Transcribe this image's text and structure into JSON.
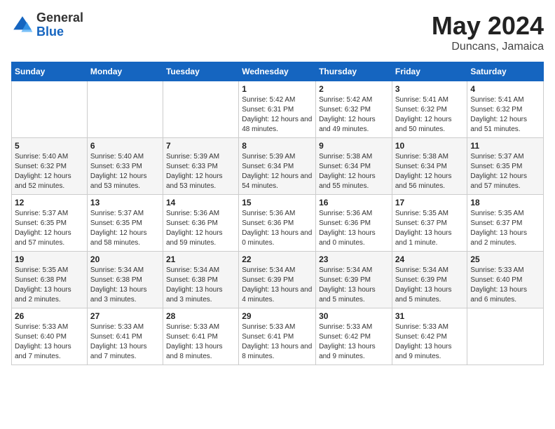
{
  "logo": {
    "general": "General",
    "blue": "Blue"
  },
  "title": "May 2024",
  "subtitle": "Duncans, Jamaica",
  "days_of_week": [
    "Sunday",
    "Monday",
    "Tuesday",
    "Wednesday",
    "Thursday",
    "Friday",
    "Saturday"
  ],
  "weeks": [
    [
      {
        "day": "",
        "sunrise": "",
        "sunset": "",
        "daylight": ""
      },
      {
        "day": "",
        "sunrise": "",
        "sunset": "",
        "daylight": ""
      },
      {
        "day": "",
        "sunrise": "",
        "sunset": "",
        "daylight": ""
      },
      {
        "day": "1",
        "sunrise": "Sunrise: 5:42 AM",
        "sunset": "Sunset: 6:31 PM",
        "daylight": "Daylight: 12 hours and 48 minutes."
      },
      {
        "day": "2",
        "sunrise": "Sunrise: 5:42 AM",
        "sunset": "Sunset: 6:32 PM",
        "daylight": "Daylight: 12 hours and 49 minutes."
      },
      {
        "day": "3",
        "sunrise": "Sunrise: 5:41 AM",
        "sunset": "Sunset: 6:32 PM",
        "daylight": "Daylight: 12 hours and 50 minutes."
      },
      {
        "day": "4",
        "sunrise": "Sunrise: 5:41 AM",
        "sunset": "Sunset: 6:32 PM",
        "daylight": "Daylight: 12 hours and 51 minutes."
      }
    ],
    [
      {
        "day": "5",
        "sunrise": "Sunrise: 5:40 AM",
        "sunset": "Sunset: 6:32 PM",
        "daylight": "Daylight: 12 hours and 52 minutes."
      },
      {
        "day": "6",
        "sunrise": "Sunrise: 5:40 AM",
        "sunset": "Sunset: 6:33 PM",
        "daylight": "Daylight: 12 hours and 53 minutes."
      },
      {
        "day": "7",
        "sunrise": "Sunrise: 5:39 AM",
        "sunset": "Sunset: 6:33 PM",
        "daylight": "Daylight: 12 hours and 53 minutes."
      },
      {
        "day": "8",
        "sunrise": "Sunrise: 5:39 AM",
        "sunset": "Sunset: 6:34 PM",
        "daylight": "Daylight: 12 hours and 54 minutes."
      },
      {
        "day": "9",
        "sunrise": "Sunrise: 5:38 AM",
        "sunset": "Sunset: 6:34 PM",
        "daylight": "Daylight: 12 hours and 55 minutes."
      },
      {
        "day": "10",
        "sunrise": "Sunrise: 5:38 AM",
        "sunset": "Sunset: 6:34 PM",
        "daylight": "Daylight: 12 hours and 56 minutes."
      },
      {
        "day": "11",
        "sunrise": "Sunrise: 5:37 AM",
        "sunset": "Sunset: 6:35 PM",
        "daylight": "Daylight: 12 hours and 57 minutes."
      }
    ],
    [
      {
        "day": "12",
        "sunrise": "Sunrise: 5:37 AM",
        "sunset": "Sunset: 6:35 PM",
        "daylight": "Daylight: 12 hours and 57 minutes."
      },
      {
        "day": "13",
        "sunrise": "Sunrise: 5:37 AM",
        "sunset": "Sunset: 6:35 PM",
        "daylight": "Daylight: 12 hours and 58 minutes."
      },
      {
        "day": "14",
        "sunrise": "Sunrise: 5:36 AM",
        "sunset": "Sunset: 6:36 PM",
        "daylight": "Daylight: 12 hours and 59 minutes."
      },
      {
        "day": "15",
        "sunrise": "Sunrise: 5:36 AM",
        "sunset": "Sunset: 6:36 PM",
        "daylight": "Daylight: 13 hours and 0 minutes."
      },
      {
        "day": "16",
        "sunrise": "Sunrise: 5:36 AM",
        "sunset": "Sunset: 6:36 PM",
        "daylight": "Daylight: 13 hours and 0 minutes."
      },
      {
        "day": "17",
        "sunrise": "Sunrise: 5:35 AM",
        "sunset": "Sunset: 6:37 PM",
        "daylight": "Daylight: 13 hours and 1 minute."
      },
      {
        "day": "18",
        "sunrise": "Sunrise: 5:35 AM",
        "sunset": "Sunset: 6:37 PM",
        "daylight": "Daylight: 13 hours and 2 minutes."
      }
    ],
    [
      {
        "day": "19",
        "sunrise": "Sunrise: 5:35 AM",
        "sunset": "Sunset: 6:38 PM",
        "daylight": "Daylight: 13 hours and 2 minutes."
      },
      {
        "day": "20",
        "sunrise": "Sunrise: 5:34 AM",
        "sunset": "Sunset: 6:38 PM",
        "daylight": "Daylight: 13 hours and 3 minutes."
      },
      {
        "day": "21",
        "sunrise": "Sunrise: 5:34 AM",
        "sunset": "Sunset: 6:38 PM",
        "daylight": "Daylight: 13 hours and 3 minutes."
      },
      {
        "day": "22",
        "sunrise": "Sunrise: 5:34 AM",
        "sunset": "Sunset: 6:39 PM",
        "daylight": "Daylight: 13 hours and 4 minutes."
      },
      {
        "day": "23",
        "sunrise": "Sunrise: 5:34 AM",
        "sunset": "Sunset: 6:39 PM",
        "daylight": "Daylight: 13 hours and 5 minutes."
      },
      {
        "day": "24",
        "sunrise": "Sunrise: 5:34 AM",
        "sunset": "Sunset: 6:39 PM",
        "daylight": "Daylight: 13 hours and 5 minutes."
      },
      {
        "day": "25",
        "sunrise": "Sunrise: 5:33 AM",
        "sunset": "Sunset: 6:40 PM",
        "daylight": "Daylight: 13 hours and 6 minutes."
      }
    ],
    [
      {
        "day": "26",
        "sunrise": "Sunrise: 5:33 AM",
        "sunset": "Sunset: 6:40 PM",
        "daylight": "Daylight: 13 hours and 7 minutes."
      },
      {
        "day": "27",
        "sunrise": "Sunrise: 5:33 AM",
        "sunset": "Sunset: 6:41 PM",
        "daylight": "Daylight: 13 hours and 7 minutes."
      },
      {
        "day": "28",
        "sunrise": "Sunrise: 5:33 AM",
        "sunset": "Sunset: 6:41 PM",
        "daylight": "Daylight: 13 hours and 8 minutes."
      },
      {
        "day": "29",
        "sunrise": "Sunrise: 5:33 AM",
        "sunset": "Sunset: 6:41 PM",
        "daylight": "Daylight: 13 hours and 8 minutes."
      },
      {
        "day": "30",
        "sunrise": "Sunrise: 5:33 AM",
        "sunset": "Sunset: 6:42 PM",
        "daylight": "Daylight: 13 hours and 9 minutes."
      },
      {
        "day": "31",
        "sunrise": "Sunrise: 5:33 AM",
        "sunset": "Sunset: 6:42 PM",
        "daylight": "Daylight: 13 hours and 9 minutes."
      },
      {
        "day": "",
        "sunrise": "",
        "sunset": "",
        "daylight": ""
      }
    ]
  ]
}
